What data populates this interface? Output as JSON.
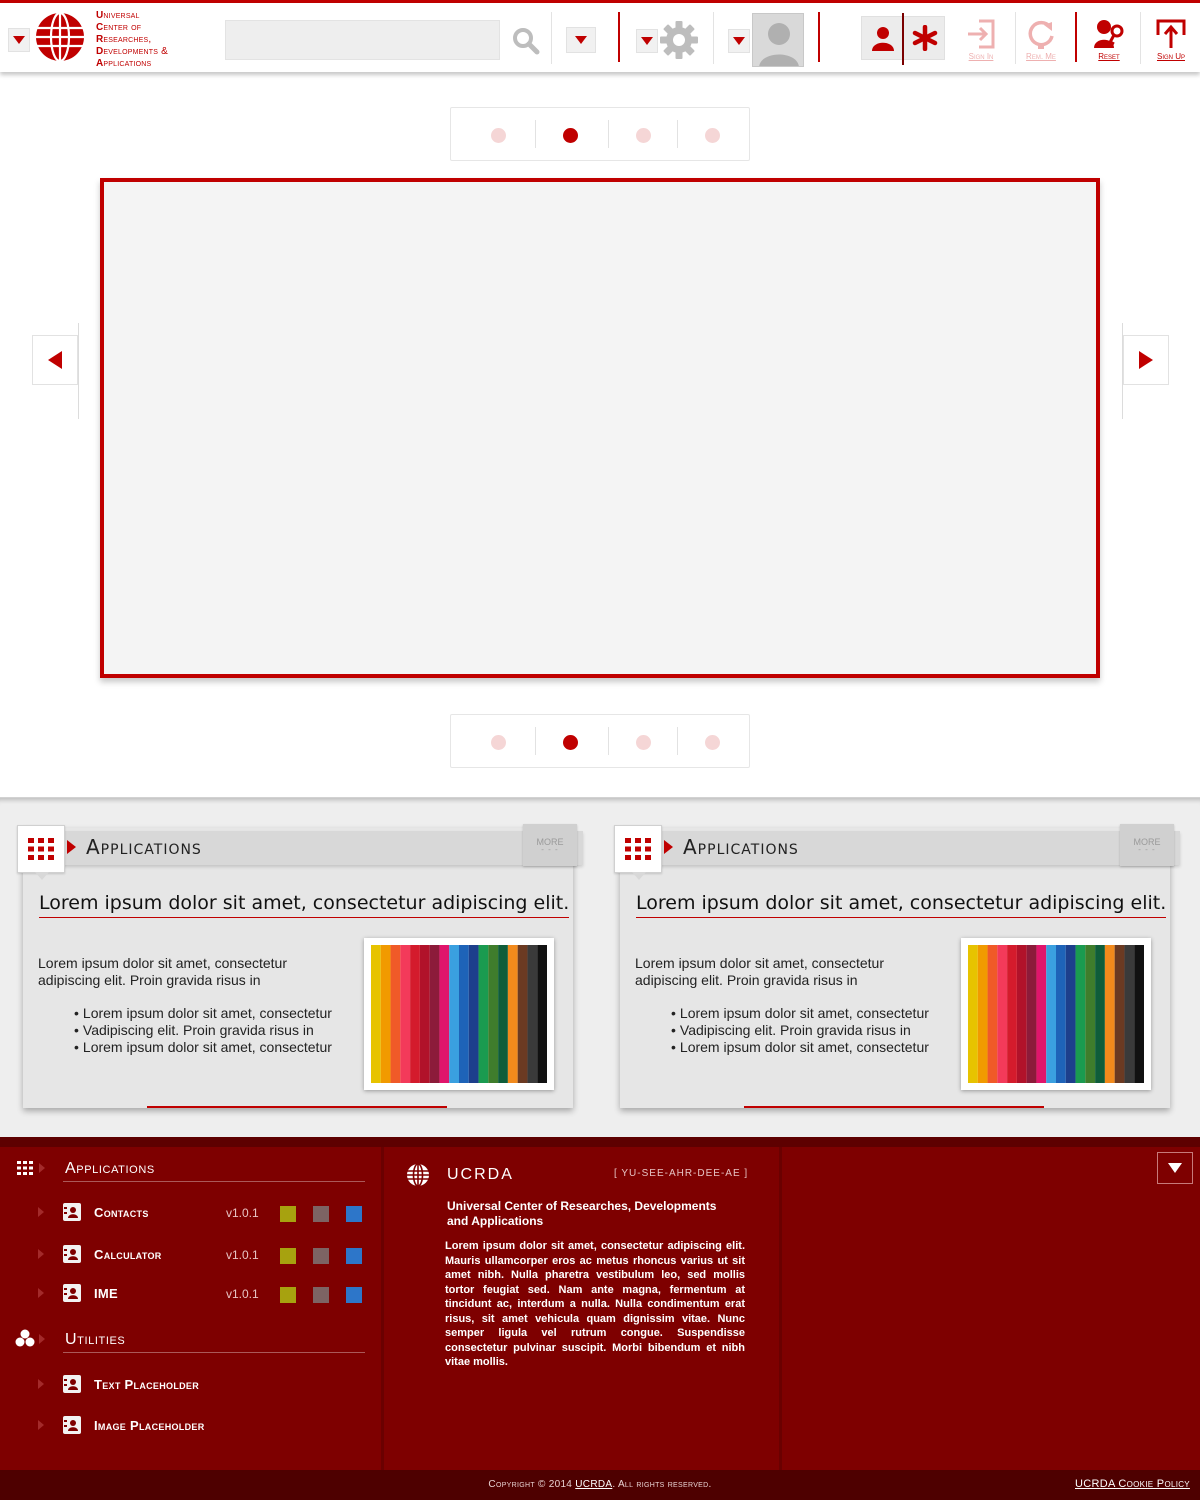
{
  "brand": {
    "lines": [
      {
        "first": "U",
        "rest": "niversal"
      },
      {
        "first": "C",
        "rest": "enter  of"
      },
      {
        "first": "R",
        "rest": "esearches,"
      },
      {
        "first": "D",
        "rest": "evelopments &"
      },
      {
        "first": "A",
        "rest": "pplications"
      }
    ],
    "accent_color": "#c00000"
  },
  "header": {
    "search_placeholder": "",
    "actions": [
      {
        "id": "sign-in",
        "label": "Sign In",
        "icon": "sign-in-icon",
        "enabled": false
      },
      {
        "id": "remember-me",
        "label": "Rem. Me",
        "icon": "refresh-icon",
        "enabled": false
      },
      {
        "id": "reset",
        "label": "Reset",
        "icon": "key-icon",
        "enabled": true
      },
      {
        "id": "sign-up",
        "label": "Sign Up",
        "icon": "sign-up-icon",
        "enabled": true
      }
    ]
  },
  "slider": {
    "page_count": 4,
    "active_page": 2
  },
  "panels": [
    {
      "title": "Applications",
      "more_label": "MORE",
      "more_dots": "- - -",
      "heading": "Lorem ipsum dolor sit amet, consectetur adipiscing elit.",
      "paragraph": "Lorem ipsum dolor sit amet, consectetur adipiscing elit. Proin gravida risus in",
      "bullets": [
        "Lorem ipsum dolor sit amet, consectetur",
        "Vadipiscing elit. Proin gravida risus in",
        "Lorem ipsum dolor sit amet, consectetur"
      ]
    },
    {
      "title": "Applications",
      "more_label": "MORE",
      "more_dots": "- - -",
      "heading": "Lorem ipsum dolor sit amet, consectetur adipiscing elit.",
      "paragraph": "Lorem ipsum dolor sit amet, consectetur adipiscing elit. Proin gravida risus in",
      "bullets": [
        "Lorem ipsum dolor sit amet, consectetur",
        "Vadipiscing elit. Proin gravida risus in",
        "Lorem ipsum dolor sit amet, consectetur"
      ]
    }
  ],
  "footer": {
    "applications_title": "Applications",
    "applications": [
      {
        "name": "Contacts",
        "version": "v1.0.1"
      },
      {
        "name": "Calculator",
        "version": "v1.0.1"
      },
      {
        "name": "IME",
        "version": "v1.0.1"
      }
    ],
    "swatch_colors": [
      "#a7a20f",
      "#7d6363",
      "#2d76c9"
    ],
    "utilities_title": "Utilities",
    "utilities": [
      {
        "name": "Text Placeholder"
      },
      {
        "name": "Image Placeholder"
      }
    ],
    "about": {
      "name": "UCRDA",
      "pronunciation": "[ YU-SEE-AHR-DEE-AE ]",
      "full_name": "Universal Center of Researches, Developments and Applications",
      "body": "Lorem ipsum dolor sit amet, consectetur adipiscing elit. Mauris ullamcorper eros ac metus rhoncus varius ut sit amet nibh. Nulla pharetra vestibulum leo, sed mollis tortor feugiat sed. Nam ante magna, fermentum at tincidunt ac, interdum a nulla. Nulla condimentum erat risus, sit amet vehicula quam dignissim vitae. Nunc semper ligula vel rutrum congue. Suspendisse consectetur pulvinar suscipit. Morbi bibendum et nibh vitae mollis."
    },
    "copyright_prefix": "Copyright © 2014",
    "copyright_link": "UCRDA",
    "copyright_suffix": ". All rights reserved.",
    "cookie_policy": "UCRDA Cookie Policy"
  }
}
